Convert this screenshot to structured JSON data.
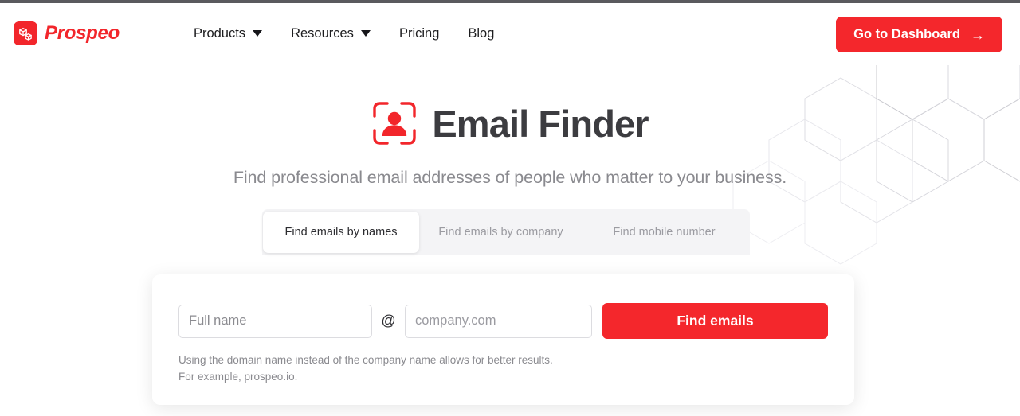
{
  "header": {
    "brand": {
      "name": "Prospeo",
      "icon": "boxes-logo-icon",
      "color": "#F2262B"
    },
    "nav": [
      {
        "label": "Products",
        "has_caret": true
      },
      {
        "label": "Resources",
        "has_caret": true
      },
      {
        "label": "Pricing",
        "has_caret": false
      },
      {
        "label": "Blog",
        "has_caret": false
      }
    ],
    "cta": {
      "label": "Go to Dashboard",
      "icon": "arrow-right-icon",
      "arrow": "→",
      "color": "#F4272C"
    }
  },
  "hero": {
    "icon": "person-scan-frame-icon",
    "title": "Email Finder",
    "subtitle": "Find professional email addresses of people who matter to your business.",
    "decoration": "hexagon-pattern"
  },
  "tabs": {
    "items": [
      {
        "label": "Find emails by names",
        "active": true
      },
      {
        "label": "Find emails by company",
        "active": false
      },
      {
        "label": "Find mobile number",
        "active": false
      }
    ]
  },
  "search": {
    "name_placeholder": "Full name",
    "name_value": "",
    "separator": "@",
    "domain_placeholder": "company.com",
    "domain_value": "",
    "submit_label": "Find emails",
    "hint_line_1": "Using the domain name instead of the company name allows for better results.",
    "hint_line_2": "For example, prospeo.io."
  }
}
